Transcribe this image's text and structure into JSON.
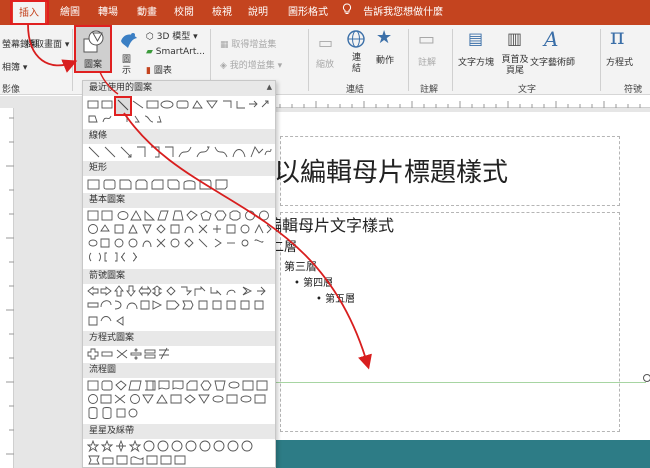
{
  "tabs": [
    {
      "label": "插入",
      "active": true
    },
    {
      "label": "繪圖"
    },
    {
      "label": "轉場"
    },
    {
      "label": "動畫"
    },
    {
      "label": "校閱"
    },
    {
      "label": "檢視"
    },
    {
      "label": "說明"
    },
    {
      "label": "圖形格式"
    }
  ],
  "tell_me": "告訴我您想做什麼",
  "ribbon": {
    "screen_recording": "螢幕錄製",
    "screen_capture": "擷取畫面",
    "album": "相簿",
    "media": "影像",
    "shapes_label": "圖案",
    "icons_label": "圖示",
    "models_3d": "3D 模型",
    "smartart": "SmartArt...",
    "chart": "圖表",
    "get_addins": "取得增益集",
    "my_addins": "我的增益集",
    "zoom": "縮放",
    "link": "連結",
    "action": "動作",
    "links_group": "連結",
    "comment": "註解",
    "comments_group": "註解",
    "textbox": "文字方塊",
    "header_footer": "頁首及頁尾",
    "wordart": "文字藝術師",
    "text_group": "文字",
    "equation": "方程式",
    "symbols_group": "符號"
  },
  "gallery": {
    "sections": [
      "最近使用的圖案",
      "線條",
      "矩形",
      "基本圖案",
      "箭號圖案",
      "方程式圖案",
      "流程圖",
      "星星及綵帶"
    ]
  },
  "slide": {
    "title": "按一下以編輯母片標題樣式",
    "level1": "編輯母片文字樣式",
    "level2": "第二層",
    "level3": "第三層",
    "level4": "第四層",
    "level5": "第五層"
  },
  "colors": {
    "accent": "#c4441f",
    "highlight": "#e02020",
    "teal": "#2d7c86"
  }
}
